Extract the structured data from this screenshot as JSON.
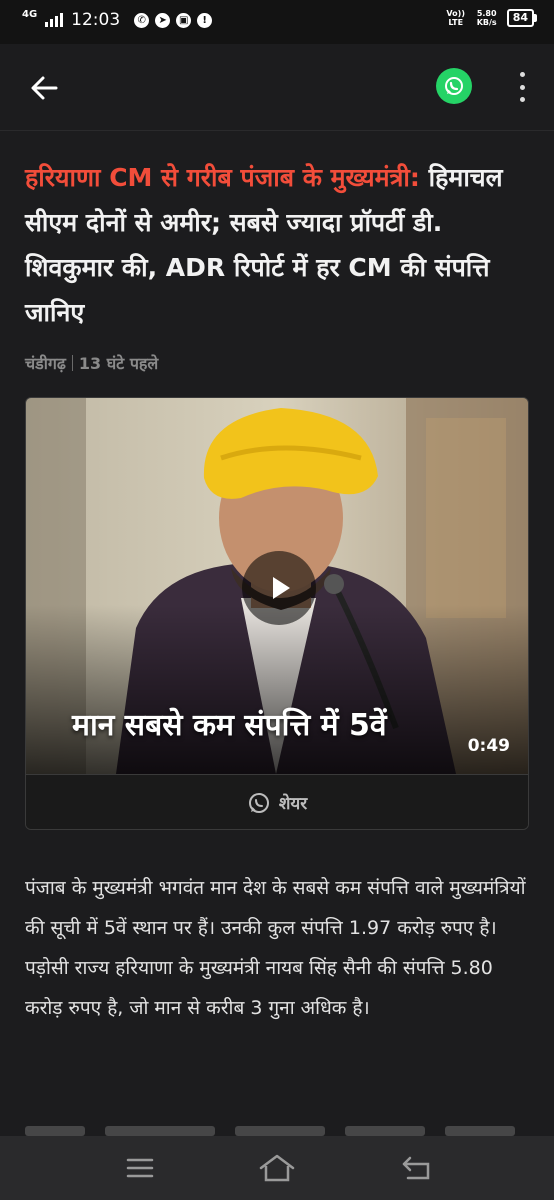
{
  "status_bar": {
    "network_type": "4G",
    "time": "12:03",
    "volte_label": "Vo)) LTE",
    "speed_value": "5.80",
    "speed_unit": "KB/s",
    "battery_level": "84",
    "icons": [
      "whatsapp-icon",
      "telegram-icon",
      "app-icon",
      "alert-icon"
    ]
  },
  "app_bar": {
    "back_icon": "arrow-left-icon",
    "whatsapp_icon": "whatsapp-icon",
    "whatsapp_color": "#25d366",
    "menu_icon": "more-vertical-icon"
  },
  "article": {
    "headline_kicker": "हरियाणा CM से गरीब पंजाब के मुख्यमंत्री:",
    "headline_rest": "हिमाचल सीएम दोनों से अमीर; सबसे ज्यादा प्रॉपर्टी डी. शिवकुमार की, ADR रिपोर्ट में हर CM की संपत्ति जानिए",
    "kicker_color": "#f24d3a",
    "location": "चंडीगढ़",
    "time_ago": "13 घंटे पहले",
    "video": {
      "caption": "मान सबसे कम संपत्ति में 5वें",
      "duration": "0:49",
      "share_label": "शेयर"
    },
    "body": "पंजाब के मुख्यमंत्री भगवंत मान देश के सबसे कम संपत्ति वाले मुख्यमंत्रियों की सूची में 5वें स्थान पर हैं। उनकी कुल संपत्ति 1.97 करोड़ रुपए है। पड़ोसी राज्य हरियाणा के मुख्यमंत्री नायब सिंह सैनी की संपत्ति 5.80 करोड़ रुपए है, जो मान से करीब 3 गुना अधिक है।"
  },
  "nav_bar": {
    "items": [
      "menu-icon",
      "home-icon",
      "back-icon"
    ]
  }
}
